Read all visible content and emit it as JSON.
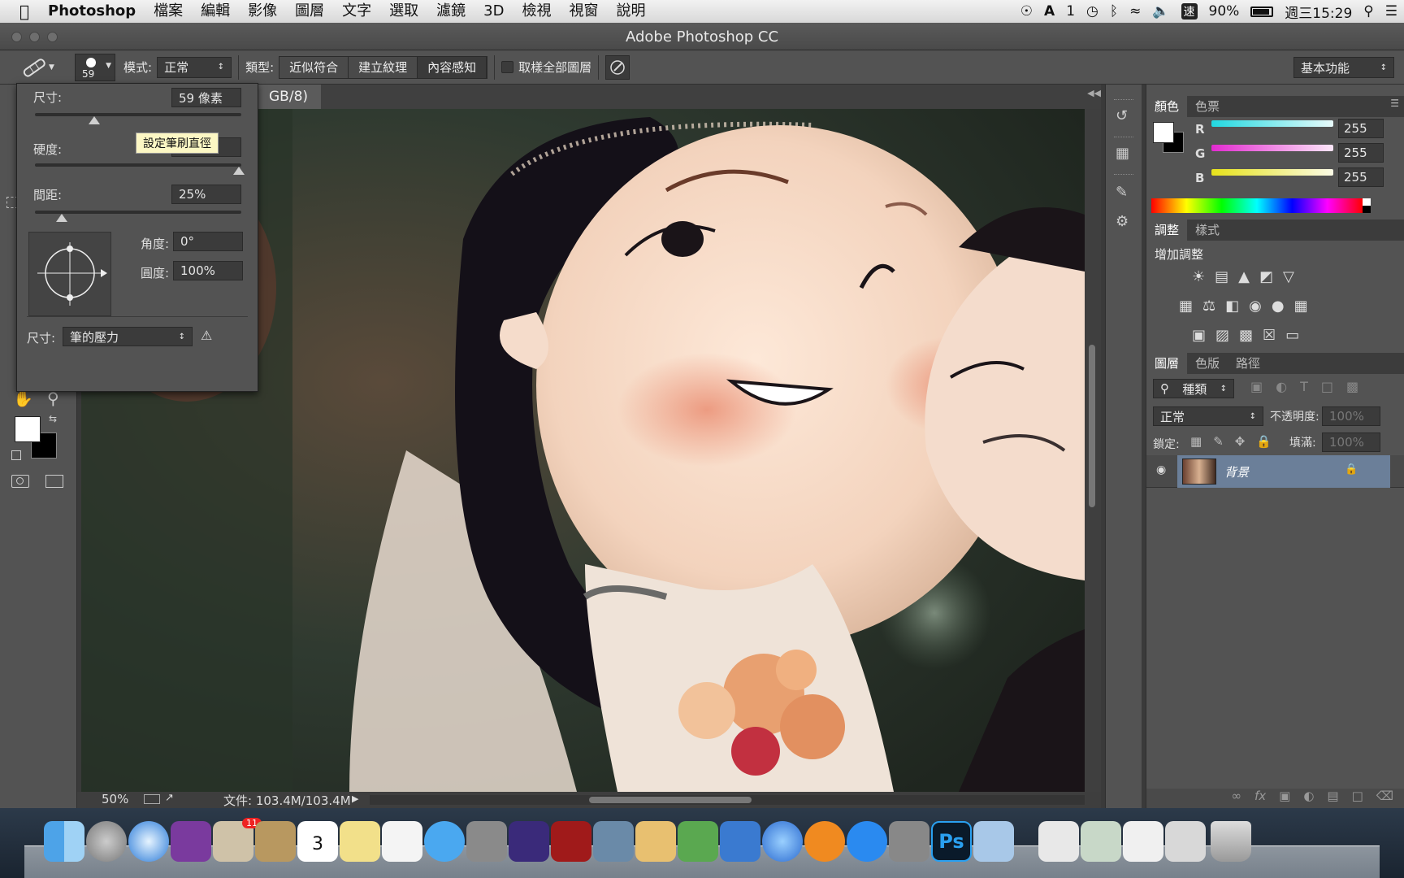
{
  "menubar": {
    "app_name": "Photoshop",
    "items": [
      "檔案",
      "編輯",
      "影像",
      "圖層",
      "文字",
      "選取",
      "濾鏡",
      "3D",
      "檢視",
      "視窗",
      "說明"
    ],
    "status_badge": "1",
    "battery": "90%",
    "clock": "週三15:29",
    "input_method": "速"
  },
  "window": {
    "title": "Adobe Photoshop CC"
  },
  "options": {
    "brush_size_preview": "59",
    "mode_label": "模式:",
    "mode_value": "正常",
    "type_label": "類型:",
    "type_options": [
      "近似符合",
      "建立紋理",
      "內容感知"
    ],
    "sample_all_label": "取樣全部圖層",
    "workspace": "基本功能"
  },
  "brush_popup": {
    "size_label": "尺寸:",
    "size_value": "59 像素",
    "hardness_label": "硬度:",
    "tooltip": "設定筆刷直徑",
    "spacing_label": "間距:",
    "spacing_value": "25%",
    "angle_label": "角度:",
    "angle_value": "0°",
    "roundness_label": "圓度:",
    "roundness_value": "100%",
    "pressure_label": "尺寸:",
    "pressure_value": "筆的壓力"
  },
  "document": {
    "tab_title": "GB/8)",
    "zoom": "50%",
    "file_info": "文件: 103.4M/103.4M"
  },
  "color_panel": {
    "tabs": [
      "顏色",
      "色票"
    ],
    "channels": [
      {
        "name": "R",
        "value": "255",
        "color": "#22d8e0"
      },
      {
        "name": "G",
        "value": "255",
        "color": "#e22ad0"
      },
      {
        "name": "B",
        "value": "255",
        "color": "#e6e21a"
      }
    ]
  },
  "adjustments_panel": {
    "tabs": [
      "調整",
      "樣式"
    ],
    "header": "增加調整"
  },
  "layers_panel": {
    "tabs": [
      "圖層",
      "色版",
      "路徑"
    ],
    "filter": "種類",
    "blend_mode": "正常",
    "opacity_label": "不透明度:",
    "opacity_value": "100%",
    "lock_label": "鎖定:",
    "fill_label": "填滿:",
    "fill_value": "100%",
    "layers": [
      {
        "name": "背景",
        "visible": true,
        "locked": true
      }
    ],
    "icon_text": "T"
  },
  "dock": {
    "notification_badge": "11",
    "calendar_day": "3",
    "photoshop_label": "Ps"
  }
}
